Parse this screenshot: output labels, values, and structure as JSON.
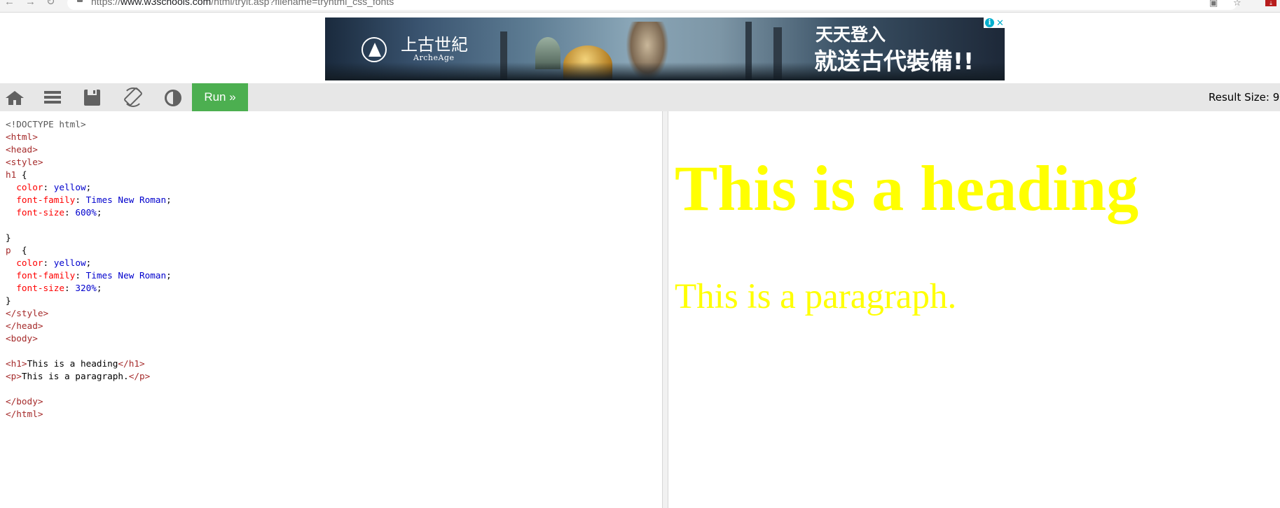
{
  "browser": {
    "url_prefix": "https://",
    "url_domain": "www.w3schools.com",
    "url_path": "/html/tryit.asp?filename=tryhtml_css_fonts",
    "back_icon": "arrow-left-icon",
    "forward_icon": "arrow-right-icon",
    "reload_icon": "reload-icon"
  },
  "ad": {
    "logo_name": "上古世紀",
    "logo_sub": "ArcheAge",
    "line1": "天天登入",
    "line2": "就送古代裝備!!",
    "info_glyph": "i",
    "close_glyph": "✕"
  },
  "toolbar": {
    "run_label": "Run »",
    "result_size_label": "Result Size: 9",
    "run_color": "#4caf50"
  },
  "editor": {
    "lines": [
      [
        [
          "doc",
          "<!DOCTYPE html>"
        ]
      ],
      [
        [
          "tag",
          "<html>"
        ]
      ],
      [
        [
          "tag",
          "<head>"
        ]
      ],
      [
        [
          "tag",
          "<style>"
        ]
      ],
      [
        [
          "sel",
          "h1"
        ],
        [
          "txt",
          " {"
        ]
      ],
      [
        [
          "txt",
          "  "
        ],
        [
          "prop",
          "color"
        ],
        [
          "txt",
          ": "
        ],
        [
          "val",
          "yellow"
        ],
        [
          "txt",
          ";"
        ]
      ],
      [
        [
          "txt",
          "  "
        ],
        [
          "prop",
          "font-family"
        ],
        [
          "txt",
          ": "
        ],
        [
          "val",
          "Times New Roman"
        ],
        [
          "txt",
          ";"
        ]
      ],
      [
        [
          "txt",
          "  "
        ],
        [
          "prop",
          "font-size"
        ],
        [
          "txt",
          ": "
        ],
        [
          "val",
          "600%"
        ],
        [
          "txt",
          ";"
        ]
      ],
      [
        [
          "txt",
          ""
        ]
      ],
      [
        [
          "txt",
          "}"
        ]
      ],
      [
        [
          "sel",
          "p"
        ],
        [
          "txt",
          "  {"
        ]
      ],
      [
        [
          "txt",
          "  "
        ],
        [
          "prop",
          "color"
        ],
        [
          "txt",
          ": "
        ],
        [
          "val",
          "yellow"
        ],
        [
          "txt",
          ";"
        ]
      ],
      [
        [
          "txt",
          "  "
        ],
        [
          "prop",
          "font-family"
        ],
        [
          "txt",
          ": "
        ],
        [
          "val",
          "Times New Roman"
        ],
        [
          "txt",
          ";"
        ]
      ],
      [
        [
          "txt",
          "  "
        ],
        [
          "prop",
          "font-size"
        ],
        [
          "txt",
          ": "
        ],
        [
          "val",
          "320%"
        ],
        [
          "txt",
          ";"
        ]
      ],
      [
        [
          "txt",
          "}"
        ]
      ],
      [
        [
          "tag",
          "</style>"
        ]
      ],
      [
        [
          "tag",
          "</head>"
        ]
      ],
      [
        [
          "tag",
          "<body>"
        ]
      ],
      [
        [
          "txt",
          ""
        ]
      ],
      [
        [
          "tag",
          "<h1>"
        ],
        [
          "txt",
          "This is a heading"
        ],
        [
          "tag",
          "</h1>"
        ]
      ],
      [
        [
          "tag",
          "<p>"
        ],
        [
          "txt",
          "This is a paragraph."
        ],
        [
          "tag",
          "</p>"
        ]
      ],
      [
        [
          "txt",
          ""
        ]
      ],
      [
        [
          "tag",
          "</body>"
        ]
      ],
      [
        [
          "tag",
          "</html>"
        ]
      ]
    ],
    "colors": {
      "tag": "#a52a2a",
      "property": "#ff0000",
      "value": "#0000cd"
    }
  },
  "result": {
    "heading": "This is a heading",
    "paragraph": "This is a paragraph.",
    "text_color": "#ffff00"
  }
}
